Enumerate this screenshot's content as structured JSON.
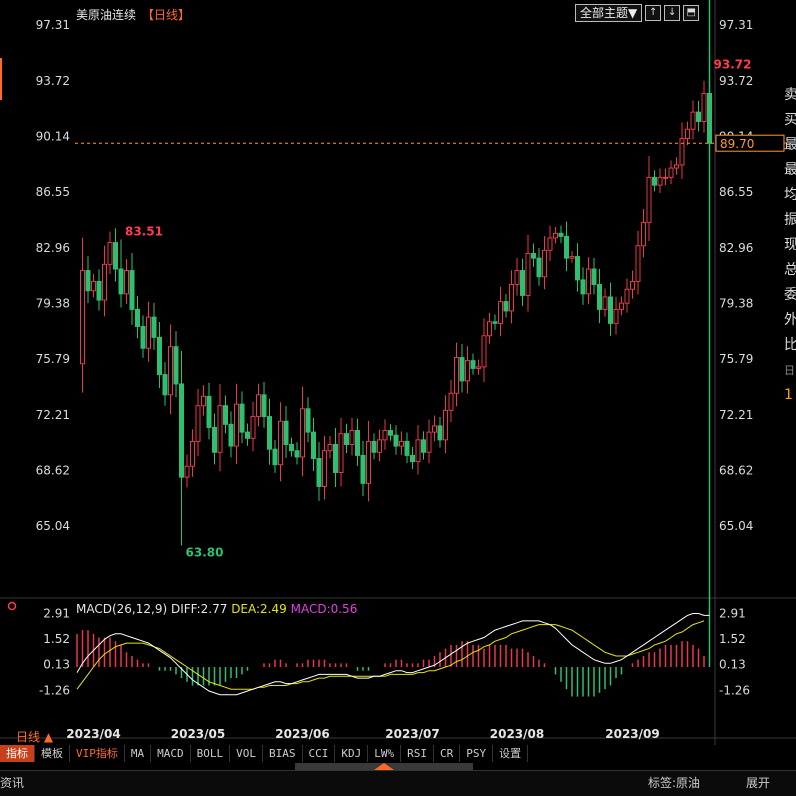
{
  "header": {
    "title": "美原油连续",
    "period": "【日线】",
    "theme_dropdown": "全部主题▼",
    "icon_buttons": [
      "↑",
      "↓",
      "⬒"
    ]
  },
  "side_panel": {
    "chars": [
      "卖",
      "买",
      "最",
      "最",
      "均",
      "振",
      "现",
      "总",
      "委",
      "外",
      "比",
      "日",
      "1"
    ]
  },
  "chart_data": [
    {
      "type": "candlestick",
      "title": "",
      "y_ticks": [
        97.31,
        93.72,
        90.14,
        86.55,
        82.96,
        79.38,
        75.79,
        72.21,
        68.62,
        65.04
      ],
      "ylim": [
        62.35,
        97.31
      ],
      "x_ticks": [
        "2023/04",
        "2023/05",
        "2023/06",
        "2023/07",
        "2023/08",
        "2023/09"
      ],
      "annotations": {
        "high": "93.72",
        "high_mid": "83.51",
        "low": "63.80"
      },
      "current_price": "89.70",
      "up_color": "#e8394b",
      "down_color": "#2fbf71",
      "path": [
        75.5,
        81.5,
        80.2,
        80.8,
        79.6,
        81.9,
        83.3,
        81.6,
        80.0,
        81.5,
        79.0,
        77.9,
        76.5,
        78.5,
        77.2,
        74.8,
        73.5,
        76.6,
        74.2,
        68.2,
        68.9,
        70.5,
        72.8,
        73.4,
        71.4,
        69.8,
        72.8,
        71.6,
        70.2,
        72.9,
        71.1,
        70.7,
        72.1,
        73.5,
        72.1,
        70.0,
        69.0,
        71.8,
        70.3,
        69.9,
        69.5,
        72.6,
        71.1,
        69.4,
        67.6,
        69.9,
        70.3,
        68.5,
        71.0,
        70.3,
        71.2,
        69.6,
        67.8,
        70.5,
        69.8,
        70.6,
        71.2,
        70.9,
        70.2,
        70.5,
        69.6,
        69.2,
        70.6,
        69.8,
        71.1,
        71.5,
        70.6,
        72.5,
        73.6,
        75.9,
        74.4,
        75.7,
        75.2,
        75.3,
        77.3,
        78.2,
        78.1,
        79.5,
        78.9,
        80.6,
        81.5,
        79.9,
        82.6,
        82.3,
        81.1,
        82.8,
        83.6,
        83.9,
        83.7,
        82.3,
        82.4,
        80.9,
        80.0,
        81.6,
        80.6,
        79.0,
        79.8,
        78.1,
        79.0,
        79.4,
        80.3,
        80.8,
        83.1,
        84.6,
        87.5,
        87.0,
        87.5,
        87.5,
        88.1,
        88.3,
        90.0,
        90.6,
        91.7,
        91.1,
        92.9,
        89.7
      ],
      "macd": {
        "params": "MACD(26,12,9)",
        "diff_label": "DIFF:2.77",
        "dea_label": "DEA:2.49",
        "macd_label": "MACD:0.56",
        "y_ticks": [
          2.91,
          1.52,
          0.13,
          -1.26
        ],
        "ylim": [
          -2.6,
          3.2
        ],
        "diff_color": "#ffffff",
        "dea_color": "#e6e600",
        "diff": [
          -0.3,
          0.2,
          0.6,
          0.9,
          1.2,
          1.5,
          1.7,
          1.8,
          1.8,
          1.7,
          1.6,
          1.5,
          1.4,
          1.3,
          1.1,
          0.9,
          0.7,
          0.5,
          0.2,
          -0.1,
          -0.4,
          -0.7,
          -0.9,
          -1.1,
          -1.3,
          -1.4,
          -1.5,
          -1.5,
          -1.5,
          -1.5,
          -1.4,
          -1.3,
          -1.2,
          -1.1,
          -1.0,
          -0.9,
          -0.8,
          -0.8,
          -0.9,
          -0.9,
          -0.8,
          -0.7,
          -0.6,
          -0.5,
          -0.4,
          -0.4,
          -0.4,
          -0.4,
          -0.4,
          -0.4,
          -0.5,
          -0.6,
          -0.6,
          -0.6,
          -0.5,
          -0.5,
          -0.4,
          -0.3,
          -0.2,
          -0.2,
          -0.3,
          -0.3,
          -0.2,
          -0.1,
          0.0,
          0.1,
          0.3,
          0.5,
          0.7,
          0.9,
          1.1,
          1.3,
          1.4,
          1.5,
          1.6,
          1.8,
          2.0,
          2.1,
          2.2,
          2.3,
          2.4,
          2.5,
          2.5,
          2.5,
          2.5,
          2.4,
          2.3,
          2.1,
          1.8,
          1.5,
          1.2,
          1.0,
          0.8,
          0.6,
          0.4,
          0.3,
          0.2,
          0.2,
          0.3,
          0.4,
          0.6,
          0.8,
          1.0,
          1.2,
          1.4,
          1.6,
          1.8,
          2.0,
          2.2,
          2.4,
          2.6,
          2.8,
          2.9,
          2.9,
          2.8,
          2.8
        ],
        "dea": [
          -1.2,
          -0.8,
          -0.4,
          0.0,
          0.4,
          0.7,
          0.9,
          1.1,
          1.2,
          1.3,
          1.3,
          1.3,
          1.3,
          1.2,
          1.1,
          1.0,
          0.8,
          0.6,
          0.4,
          0.2,
          0.0,
          -0.2,
          -0.4,
          -0.6,
          -0.8,
          -0.9,
          -1.0,
          -1.1,
          -1.2,
          -1.2,
          -1.2,
          -1.2,
          -1.2,
          -1.1,
          -1.1,
          -1.0,
          -1.0,
          -1.0,
          -1.0,
          -0.9,
          -0.9,
          -0.8,
          -0.8,
          -0.7,
          -0.6,
          -0.6,
          -0.5,
          -0.5,
          -0.5,
          -0.5,
          -0.5,
          -0.5,
          -0.5,
          -0.5,
          -0.5,
          -0.5,
          -0.5,
          -0.4,
          -0.4,
          -0.4,
          -0.4,
          -0.4,
          -0.3,
          -0.3,
          -0.2,
          -0.2,
          -0.1,
          0.0,
          0.1,
          0.3,
          0.4,
          0.6,
          0.8,
          0.9,
          1.1,
          1.2,
          1.4,
          1.5,
          1.6,
          1.8,
          1.9,
          2.0,
          2.1,
          2.2,
          2.3,
          2.3,
          2.3,
          2.3,
          2.2,
          2.1,
          2.0,
          1.8,
          1.6,
          1.4,
          1.2,
          1.0,
          0.8,
          0.7,
          0.6,
          0.6,
          0.6,
          0.7,
          0.8,
          0.9,
          1.0,
          1.2,
          1.3,
          1.4,
          1.6,
          1.8,
          1.9,
          2.1,
          2.3,
          2.4,
          2.5
        ]
      }
    }
  ],
  "period_label": "日线 ▲",
  "bottom_tabs": [
    "指标",
    "模板",
    "VIP指标",
    "MA",
    "MACD",
    "BOLL",
    "VOL",
    "BIAS",
    "CCI",
    "KDJ",
    "LW%",
    "RSI",
    "CR",
    "PSY",
    "设置"
  ],
  "status_bar": {
    "left": "资讯",
    "tag": "标签:原油",
    "expand": "展开"
  }
}
